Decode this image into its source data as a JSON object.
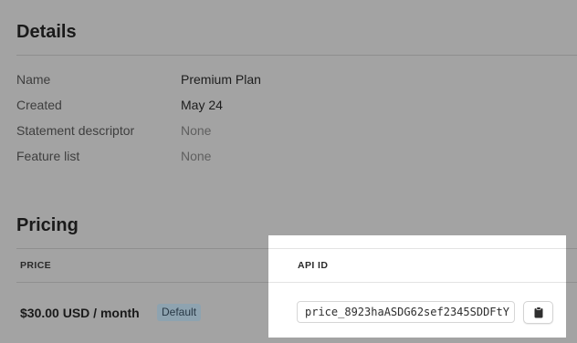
{
  "details": {
    "title": "Details",
    "rows": [
      {
        "label": "Name",
        "value": "Premium Plan",
        "muted": false
      },
      {
        "label": "Created",
        "value": "May 24",
        "muted": false
      },
      {
        "label": "Statement descriptor",
        "value": "None",
        "muted": true
      },
      {
        "label": "Feature list",
        "value": "None",
        "muted": true
      }
    ]
  },
  "pricing": {
    "title": "Pricing",
    "columns": {
      "price": "PRICE",
      "api_id": "API ID"
    },
    "row": {
      "price": "$30.00 USD / month",
      "badge": "Default",
      "api_id": "price_8923haASDG62sef2345SDDFtY"
    }
  },
  "icons": {
    "copy": "clipboard-icon"
  }
}
